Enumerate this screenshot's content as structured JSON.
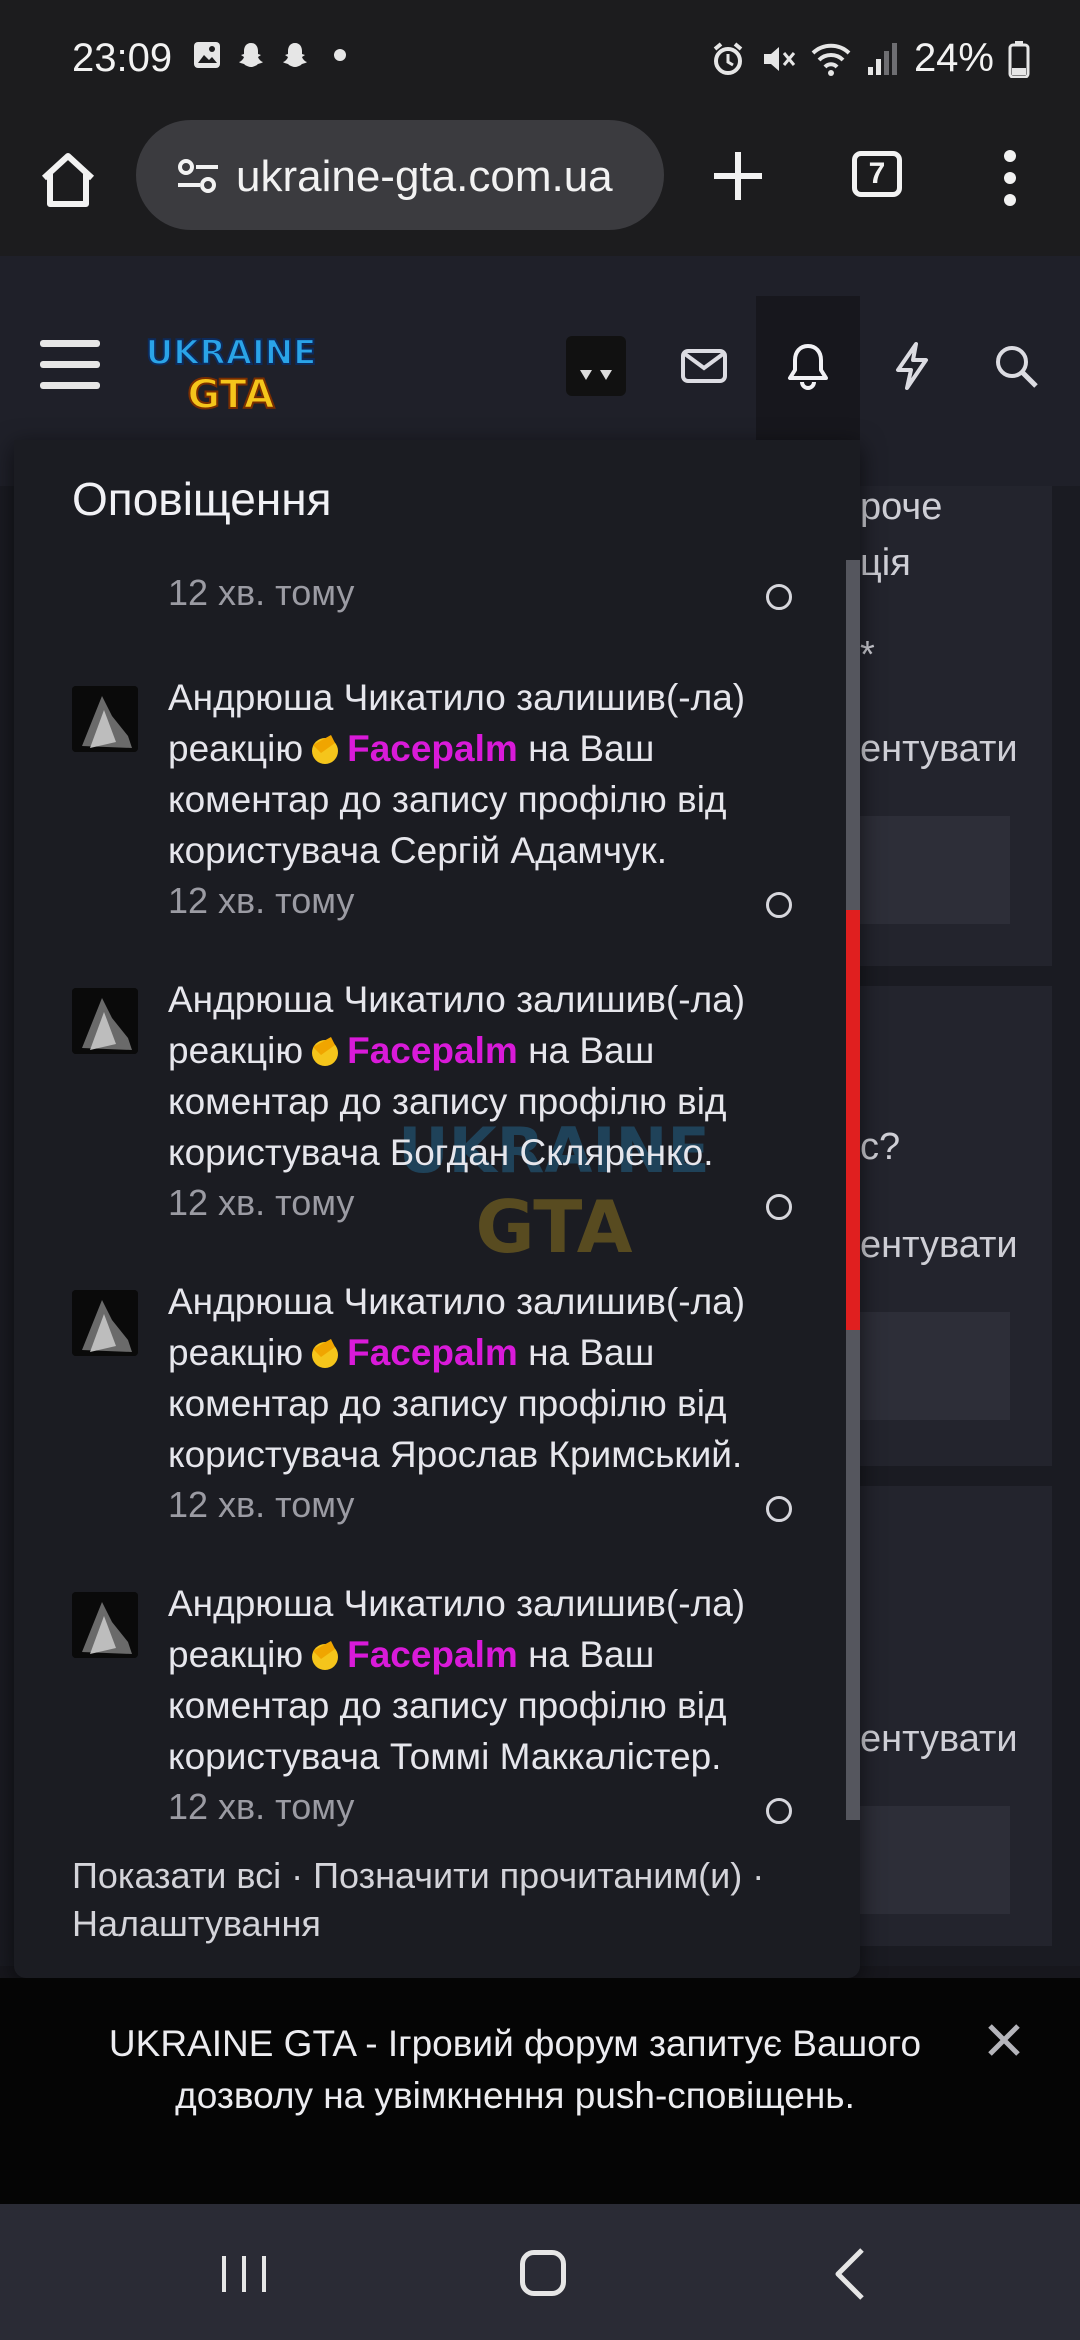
{
  "status_bar": {
    "time": "23:09",
    "icons_left": [
      "gallery-icon",
      "snapchat-icon",
      "snapchat-icon",
      "dot-icon"
    ],
    "icons_right": [
      "alarm-icon",
      "mute-icon",
      "wifi-icon",
      "signal-icon"
    ],
    "battery": "24%"
  },
  "browser": {
    "url_faded": "",
    "url": "ukraine-gta.com.ua",
    "tab_count": "7"
  },
  "site_header": {
    "logo_line1": "UKRAINE",
    "logo_line2": "GTA"
  },
  "background_page": {
    "fragments": [
      "роче",
      "ція",
      "*",
      "ентувати",
      "с?",
      "ентувати",
      "ентувати"
    ]
  },
  "notifications": {
    "title": "Оповіщення",
    "cut_item_time": "12 хв. тому",
    "items": [
      {
        "actor": "Андрюша Чикатило",
        "text_before": "залишив(-ла) реакцію",
        "reaction": "Facepalm",
        "text_after": "на Ваш коментар до запису профілю від користувача Сергій Адамчук.",
        "time": "12 хв. тому"
      },
      {
        "actor": "Андрюша Чикатило",
        "text_before": "залишив(-ла) реакцію",
        "reaction": "Facepalm",
        "text_after": "на Ваш коментар до запису профілю від користувача Богдан Скляренко.",
        "time": "12 хв. тому"
      },
      {
        "actor": "Андрюша Чикатило",
        "text_before": "залишив(-ла) реакцію",
        "reaction": "Facepalm",
        "text_after": "на Ваш коментар до запису профілю від користувача Ярослав Кримський.",
        "time": "12 хв. тому"
      },
      {
        "actor": "Андрюша Чикатило",
        "text_before": "залишив(-ла) реакцію",
        "reaction": "Facepalm",
        "text_after": "на Ваш коментар до запису профілю від користувача Томмі Маккалістер.",
        "time": "12 хв. тому"
      }
    ],
    "footer": {
      "show_all": "Показати всі",
      "sep": " · ",
      "mark_read": "Позначити прочитаним(и)",
      "settings": "Налаштування"
    }
  },
  "push_banner": {
    "text": "UKRAINE GTA - Ігровий форум запитує Вашого дозволу на увімкнення push-сповіщень."
  },
  "colors": {
    "reaction": "#d91ad9",
    "scroll_thumb": "#e01f1f",
    "popup_bg": "#1b1c22"
  }
}
